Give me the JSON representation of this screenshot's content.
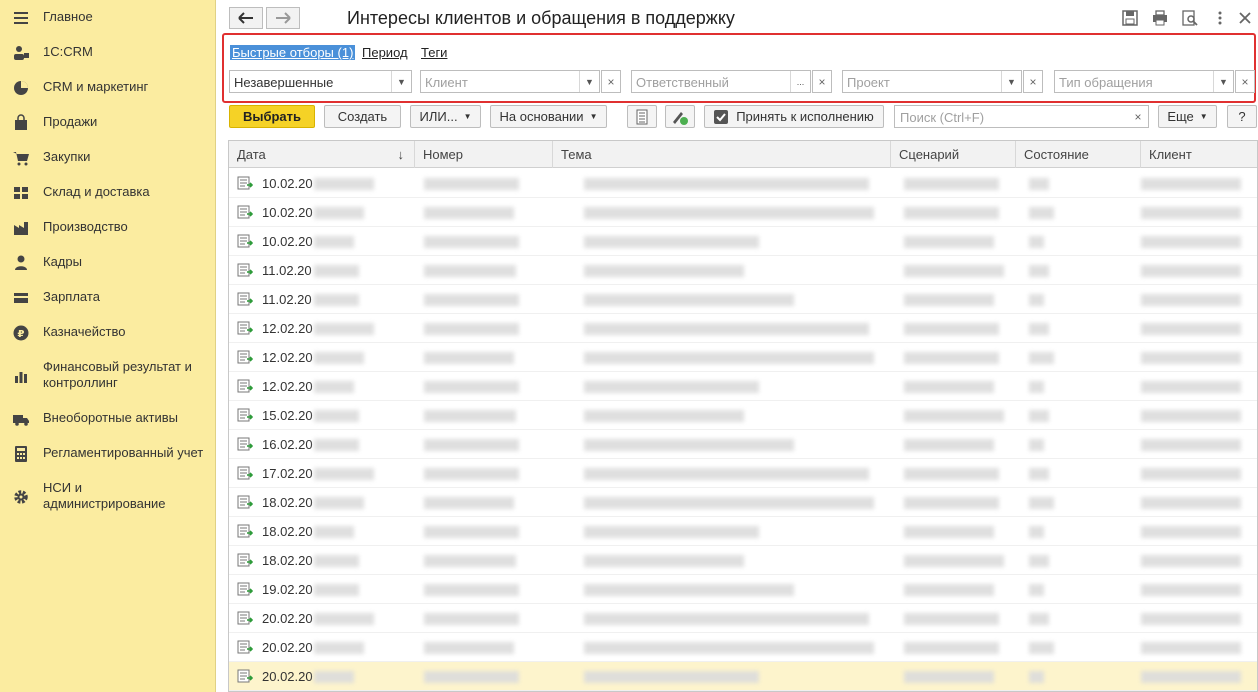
{
  "sidebar": {
    "items": [
      {
        "label": "Главное",
        "icon": "menu-icon"
      },
      {
        "label": "1С:CRM",
        "icon": "crm-icon"
      },
      {
        "label": "CRM и маркетинг",
        "icon": "pie-chart-icon"
      },
      {
        "label": "Продажи",
        "icon": "bag-icon"
      },
      {
        "label": "Закупки",
        "icon": "cart-icon"
      },
      {
        "label": "Склад и доставка",
        "icon": "warehouse-icon"
      },
      {
        "label": "Производство",
        "icon": "factory-icon"
      },
      {
        "label": "Кадры",
        "icon": "person-icon"
      },
      {
        "label": "Зарплата",
        "icon": "wallet-icon"
      },
      {
        "label": "Казначейство",
        "icon": "ruble-icon"
      },
      {
        "label": "Финансовый результат и контроллинг",
        "icon": "bar-chart-icon"
      },
      {
        "label": "Внеоборотные активы",
        "icon": "truck-icon"
      },
      {
        "label": "Регламентированный учет",
        "icon": "calculator-icon"
      },
      {
        "label": "НСИ и администрирование",
        "icon": "gear-icon"
      }
    ]
  },
  "header": {
    "title": "Интересы клиентов и обращения в поддержку"
  },
  "filters": {
    "links": [
      "Быстрые отборы (1)",
      "Период",
      "Теги"
    ],
    "status_value": "Незавершенные",
    "client_placeholder": "Клиент",
    "responsible_placeholder": "Ответственный",
    "responsible_more": "...",
    "project_placeholder": "Проект",
    "type_placeholder": "Тип обращения"
  },
  "toolbar": {
    "select": "Выбрать",
    "create": "Создать",
    "or": "ИЛИ...",
    "based_on": "На основании",
    "accept": "Принять к исполнению",
    "search_placeholder": "Поиск (Ctrl+F)",
    "more": "Еще",
    "help": "?"
  },
  "table": {
    "columns": [
      "Дата",
      "Номер",
      "Тема",
      "Сценарий",
      "Состояние",
      "Клиент"
    ],
    "sort_indicator": "↓",
    "rows": [
      "10.02.20",
      "10.02.20",
      "10.02.20",
      "11.02.20",
      "11.02.20",
      "12.02.20",
      "12.02.20",
      "12.02.20",
      "15.02.20",
      "16.02.20",
      "17.02.20",
      "18.02.20",
      "18.02.20",
      "18.02.20",
      "19.02.20",
      "20.02.20",
      "20.02.20",
      "20.02.20"
    ],
    "selected_row": 17
  },
  "colors": {
    "sidebar_bg": "#fbeca0",
    "primary_button": "#f5d226",
    "filter_border": "#e03030",
    "active_link": "#4a90d9"
  }
}
